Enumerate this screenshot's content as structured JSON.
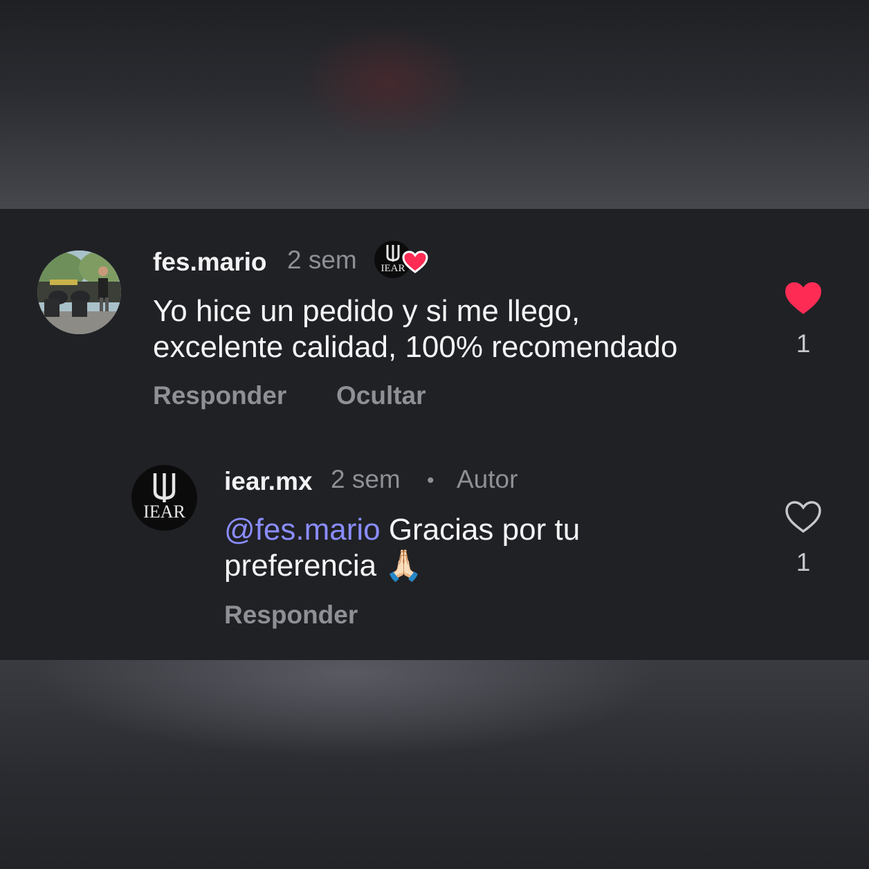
{
  "comment": {
    "username": "fes.mario",
    "time": "2 sem",
    "text_line1": "Yo hice un pedido y si me llego,",
    "text_line2": "excelente calidad, 100% recomendado",
    "reply_label": "Responder",
    "hide_label": "Ocultar",
    "like_count": "1",
    "liked": true,
    "creator_logo_text": "IEAR"
  },
  "reply": {
    "username": "iear.mx",
    "time": "2 sem",
    "separator": "•",
    "author_badge": "Autor",
    "mention": "@fes.mario",
    "text_line1_rest": " Gracias por tu",
    "text_line2": "preferencia 🙏🏻",
    "reply_label": "Responder",
    "like_count": "1",
    "liked": false,
    "logo_text": "IEAR"
  },
  "colors": {
    "heart_liked": "#fe2c55",
    "mention": "#8a8dff",
    "panel": "#202125"
  },
  "icons": [
    "heart-filled-icon",
    "heart-outline-icon",
    "creator-liked-heart-icon"
  ]
}
